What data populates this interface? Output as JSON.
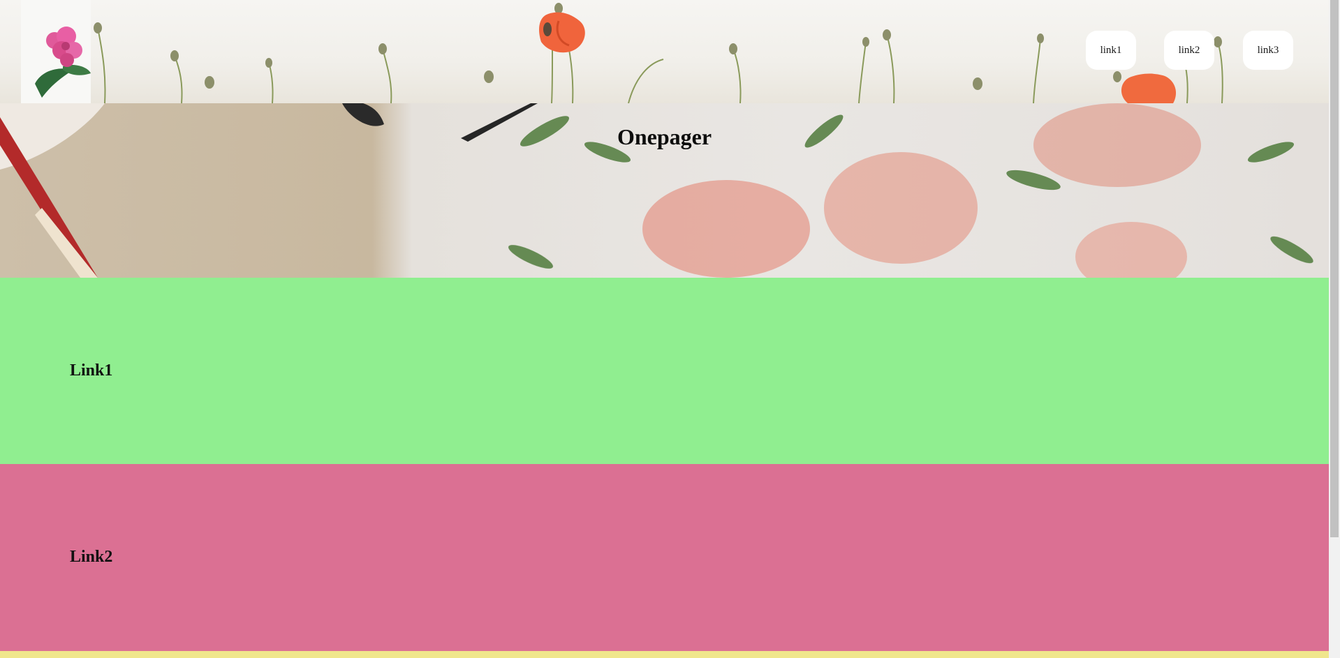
{
  "header": {
    "logo_icon": "flower-logo-icon",
    "nav": [
      {
        "label": "link1"
      },
      {
        "label": "link2"
      },
      {
        "label": "link3"
      }
    ]
  },
  "hero": {
    "title": "Onepager"
  },
  "sections": [
    {
      "heading": "Link1",
      "color": "#90ee90"
    },
    {
      "heading": "Link2",
      "color": "#db7093"
    },
    {
      "heading": "",
      "color": "#f0e68c"
    }
  ]
}
